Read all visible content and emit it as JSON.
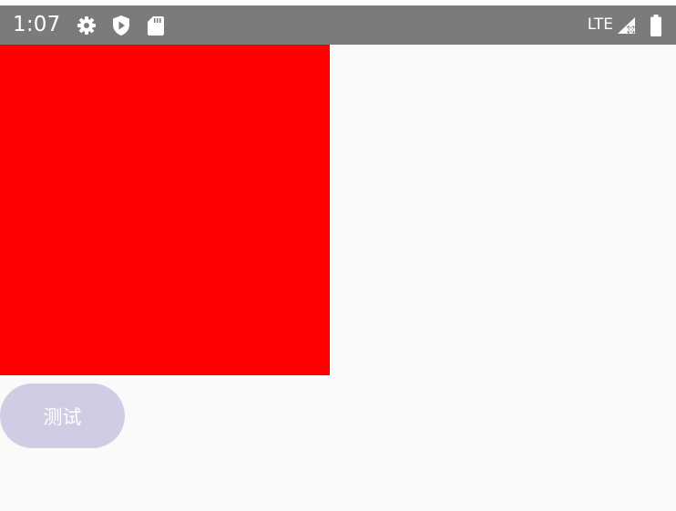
{
  "status_bar": {
    "time": "1:07",
    "network": "LTE",
    "icons": [
      "settings-gear-icon",
      "shield-icon",
      "sd-card-icon",
      "signal-no-data-icon",
      "battery-full-icon"
    ],
    "background_color": "#7b7b7b"
  },
  "content": {
    "box_color": "#ff0000",
    "button_label": "测试",
    "button_color": "#cfcde3"
  }
}
